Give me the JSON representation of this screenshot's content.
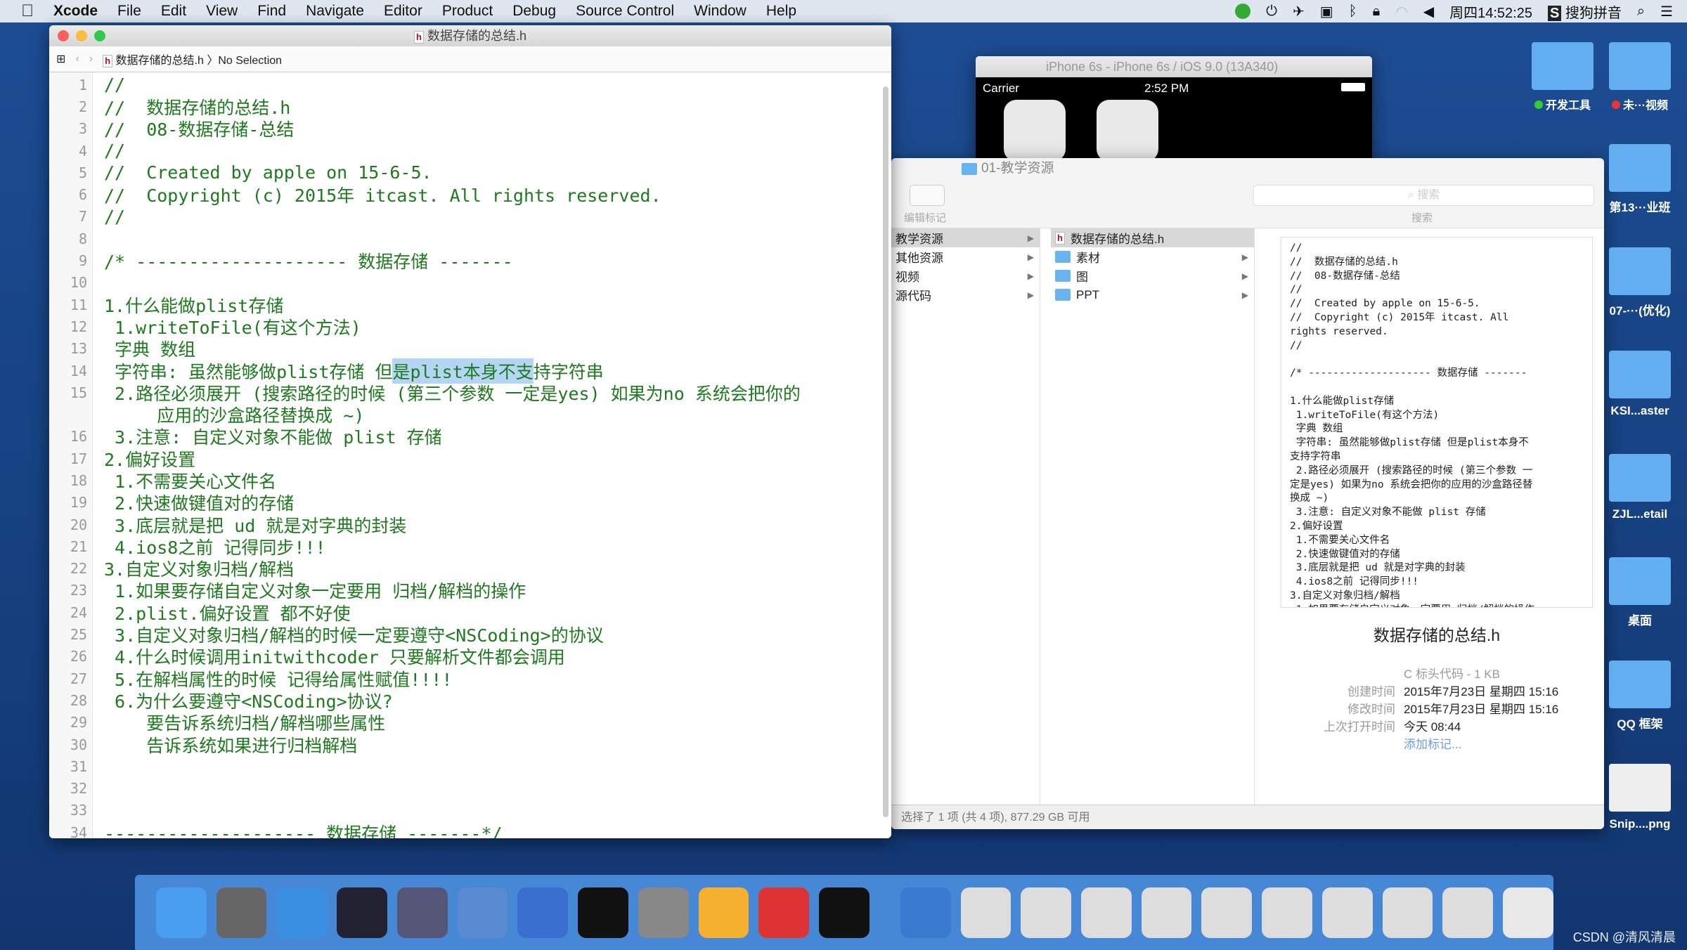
{
  "menubar": {
    "app": "Xcode",
    "items": [
      "File",
      "Edit",
      "View",
      "Find",
      "Navigate",
      "Editor",
      "Product",
      "Debug",
      "Source Control",
      "Window",
      "Help"
    ],
    "clock": "周四14:52:25",
    "input_method": "搜狗拼音"
  },
  "xcode": {
    "title": "数据存储的总结.h",
    "breadcrumb_file": "数据存储的总结.h",
    "breadcrumb_selection": "No Selection",
    "lines": [
      {
        "n": "1",
        "t": "//"
      },
      {
        "n": "2",
        "t": "//  数据存储的总结.h"
      },
      {
        "n": "3",
        "t": "//  08-数据存储-总结"
      },
      {
        "n": "4",
        "t": "//"
      },
      {
        "n": "5",
        "t": "//  Created by apple on 15-6-5."
      },
      {
        "n": "6",
        "t": "//  Copyright (c) 2015年 itcast. All rights reserved."
      },
      {
        "n": "7",
        "t": "//"
      },
      {
        "n": "8",
        "t": ""
      },
      {
        "n": "9",
        "t": "/* -------------------- 数据存储 -------"
      },
      {
        "n": "10",
        "t": ""
      },
      {
        "n": "11",
        "t": "1.什么能做plist存储"
      },
      {
        "n": "12",
        "t": " 1.writeToFile(有这个方法)"
      },
      {
        "n": "13",
        "t": " 字典 数组"
      },
      {
        "n": "14",
        "t": " 字符串: 虽然能够做plist存储 但",
        "hl": "是plist本身不支",
        "post": "持字符串"
      },
      {
        "n": "15",
        "t": " 2.路径必须展开 (搜索路径的时候 (第三个参数 一定是yes) 如果为no 系统会把你的"
      },
      {
        "n": "",
        "t": "     应用的沙盒路径替换成 ~)"
      },
      {
        "n": "16",
        "t": " 3.注意: 自定义对象不能做 plist 存储"
      },
      {
        "n": "17",
        "t": "2.偏好设置"
      },
      {
        "n": "18",
        "t": " 1.不需要关心文件名"
      },
      {
        "n": "19",
        "t": " 2.快速做键值对的存储"
      },
      {
        "n": "20",
        "t": " 3.底层就是把 ud 就是对字典的封装"
      },
      {
        "n": "21",
        "t": " 4.ios8之前 记得同步!!!"
      },
      {
        "n": "22",
        "t": "3.自定义对象归档/解档"
      },
      {
        "n": "23",
        "t": " 1.如果要存储自定义对象一定要用 归档/解档的操作"
      },
      {
        "n": "24",
        "t": " 2.plist.偏好设置 都不好使"
      },
      {
        "n": "25",
        "t": " 3.自定义对象归档/解档的时候一定要遵守<NSCoding>的协议"
      },
      {
        "n": "26",
        "t": " 4.什么时候调用initwithcoder 只要解析文件都会调用"
      },
      {
        "n": "27",
        "t": " 5.在解档属性的时候 记得给属性赋值!!!!"
      },
      {
        "n": "28",
        "t": " 6.为什么要遵守<NSCoding>协议?"
      },
      {
        "n": "29",
        "t": "    要告诉系统归档/解档哪些属性"
      },
      {
        "n": "30",
        "t": "    告诉系统如果进行归档解档"
      },
      {
        "n": "31",
        "t": ""
      },
      {
        "n": "32",
        "t": ""
      },
      {
        "n": "33",
        "t": ""
      },
      {
        "n": "34",
        "t": "-------------------- 数据存储 -------*/"
      }
    ]
  },
  "simulator": {
    "title": "iPhone 6s - iPhone 6s / iOS 9.0 (13A340)",
    "carrier": "Carrier",
    "time": "2:52 PM"
  },
  "finder": {
    "title": "01-教学资源",
    "tag_label": "编辑标记",
    "search_placeholder": "搜索",
    "search_label": "搜索",
    "col1": [
      "教学资源",
      "其他资源",
      "视频",
      "源代码"
    ],
    "col2": [
      {
        "name": "数据存储的总结.h",
        "type": "file"
      },
      {
        "name": "素材",
        "type": "folder"
      },
      {
        "name": "图",
        "type": "folder"
      },
      {
        "name": "PPT",
        "type": "folder"
      }
    ],
    "preview_text": "//\n//  数据存储的总结.h\n//  08-数据存储-总结\n//\n//  Created by apple on 15-6-5.\n//  Copyright (c) 2015年 itcast. All\nrights reserved.\n//\n\n/* -------------------- 数据存储 -------\n\n1.什么能做plist存储\n 1.writeToFile(有这个方法)\n 字典 数组\n 字符串: 虽然能够做plist存储 但是plist本身不\n支持字符串\n 2.路径必须展开 (搜索路径的时候 (第三个参数 一\n定是yes) 如果为no 系统会把你的应用的沙盒路径替\n换成 ~)\n 3.注意: 自定义对象不能做 plist 存储\n2.偏好设置\n 1.不需要关心文件名\n 2.快速做键值对的存储\n 3.底层就是把 ud 就是对字典的封装\n 4.ios8之前 记得同步!!!\n3.自定义对象归档/解档\n 1.如果要存储自定义对象一定要用 归档/解档的操作",
    "preview_name": "数据存储的总结.h",
    "kind": "C 标头代码 - 1 KB",
    "meta": [
      {
        "k": "创建时间",
        "v": "2015年7月23日 星期四 15:16"
      },
      {
        "k": "修改时间",
        "v": "2015年7月23日 星期四 15:16"
      },
      {
        "k": "上次打开时间",
        "v": "今天 08:44"
      }
    ],
    "add_tag": "添加标记...",
    "status": "选择了 1 项 (共 4 项), 877.29 GB 可用"
  },
  "desktop": {
    "top": [
      "开发工具",
      "未···视频"
    ],
    "icons": [
      "第13···业班",
      "07-···(优化)",
      "KSI...aster",
      "ZJL...etail",
      "桌面",
      "QQ 框架",
      "Snip....png"
    ]
  },
  "watermark": "CSDN @清风清晨",
  "colors": {
    "desktop": "#16407f",
    "comment_green": "#1f7a1f",
    "selection": "#b5d5f5",
    "folder": "#62aef0"
  }
}
